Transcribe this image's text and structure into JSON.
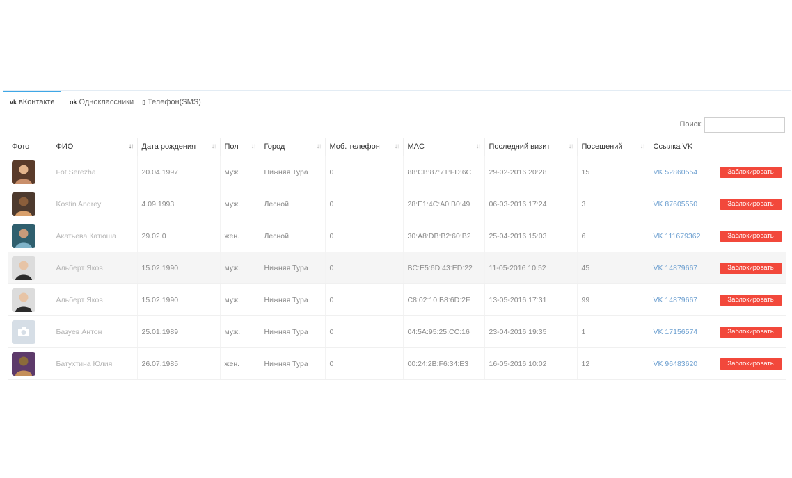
{
  "tabs": [
    {
      "icon": "vk",
      "label": "вКонтакте"
    },
    {
      "icon": "ok",
      "label": "Одноклассники"
    },
    {
      "icon": "▯",
      "label": "Телефон(SMS)"
    }
  ],
  "search": {
    "label": "Поиск:",
    "value": ""
  },
  "columns": [
    "Фото",
    "ФИО",
    "Дата рождения",
    "Пол",
    "Город",
    "Моб. телефон",
    "MAC",
    "Последний визит",
    "Посещений",
    "Ссылка VK",
    ""
  ],
  "sort_icon": "↓↑",
  "block_label": "Заблокировать",
  "rows": [
    {
      "photo": "avatar-photo",
      "name": "Fot Serezha",
      "birth": "20.04.1997",
      "sex": "муж.",
      "city": "Нижняя Тура",
      "phone": "0",
      "mac": "88:CB:87:71:FD:6C",
      "visit": "29-02-2016 20:28",
      "visits": "15",
      "vk": "VK 52860554"
    },
    {
      "photo": "avatar-photo",
      "name": "Kostin Andrey",
      "birth": "4.09.1993",
      "sex": "муж.",
      "city": "Лесной",
      "phone": "0",
      "mac": "28:E1:4C:A0:B0:49",
      "visit": "06-03-2016 17:24",
      "visits": "3",
      "vk": "VK 87605550"
    },
    {
      "photo": "avatar-photo",
      "name": "Акатьева Катюша",
      "birth": "29.02.0",
      "sex": "жен.",
      "city": "Лесной",
      "phone": "0",
      "mac": "30:A8:DB:B2:60:B2",
      "visit": "25-04-2016 15:03",
      "visits": "6",
      "vk": "VK 111679362"
    },
    {
      "photo": "avatar-photo",
      "name": "Альберт Яков",
      "birth": "15.02.1990",
      "sex": "муж.",
      "city": "Нижняя Тура",
      "phone": "0",
      "mac": "BC:E5:6D:43:ED:22",
      "visit": "11-05-2016 10:52",
      "visits": "45",
      "vk": "VK 14879667"
    },
    {
      "photo": "avatar-photo",
      "name": "Альберт Яков",
      "birth": "15.02.1990",
      "sex": "муж.",
      "city": "Нижняя Тура",
      "phone": "0",
      "mac": "C8:02:10:B8:6D:2F",
      "visit": "13-05-2016 17:31",
      "visits": "99",
      "vk": "VK 14879667"
    },
    {
      "photo": "camera-placeholder",
      "name": "Базуев Антон",
      "birth": "25.01.1989",
      "sex": "муж.",
      "city": "Нижняя Тура",
      "phone": "0",
      "mac": "04:5A:95:25:CC:16",
      "visit": "23-04-2016 19:35",
      "visits": "1",
      "vk": "VK 17156574"
    },
    {
      "photo": "avatar-photo",
      "name": "Батухтина Юлия",
      "birth": "26.07.1985",
      "sex": "жен.",
      "city": "Нижняя Тура",
      "phone": "0",
      "mac": "00:24:2B:F6:34:E3",
      "visit": "16-05-2016 10:02",
      "visits": "12",
      "vk": "VK 96483620"
    }
  ],
  "colors": {
    "accent": "#3fa7e6",
    "link": "#6c9fd0",
    "danger": "#f2483b"
  }
}
